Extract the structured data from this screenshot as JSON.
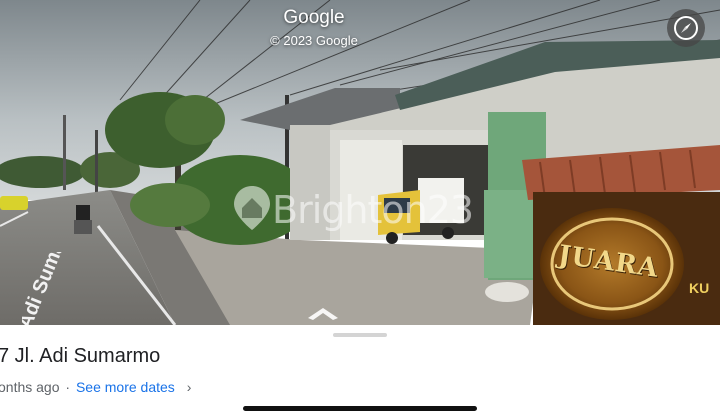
{
  "header": {
    "title": "Google",
    "copyright": "© 2023 Google"
  },
  "icons": {
    "compass": "compass-icon",
    "nav_arrow": "chevron-up-icon",
    "see_more_chevron": "chevron-right-icon"
  },
  "scene": {
    "watermark_text": "Brighton23",
    "sign_text": "JUARA",
    "sign_suffix": "KU",
    "road_marking": "Adi Sumarmo"
  },
  "place": {
    "address": "7 Jl. Adi Sumarmo",
    "age": "onths ago",
    "separator": "·",
    "see_more": "See more dates"
  },
  "colors": {
    "link": "#1a73e8",
    "sky": "#9aa3a8",
    "door_green": "#6fa77a"
  }
}
